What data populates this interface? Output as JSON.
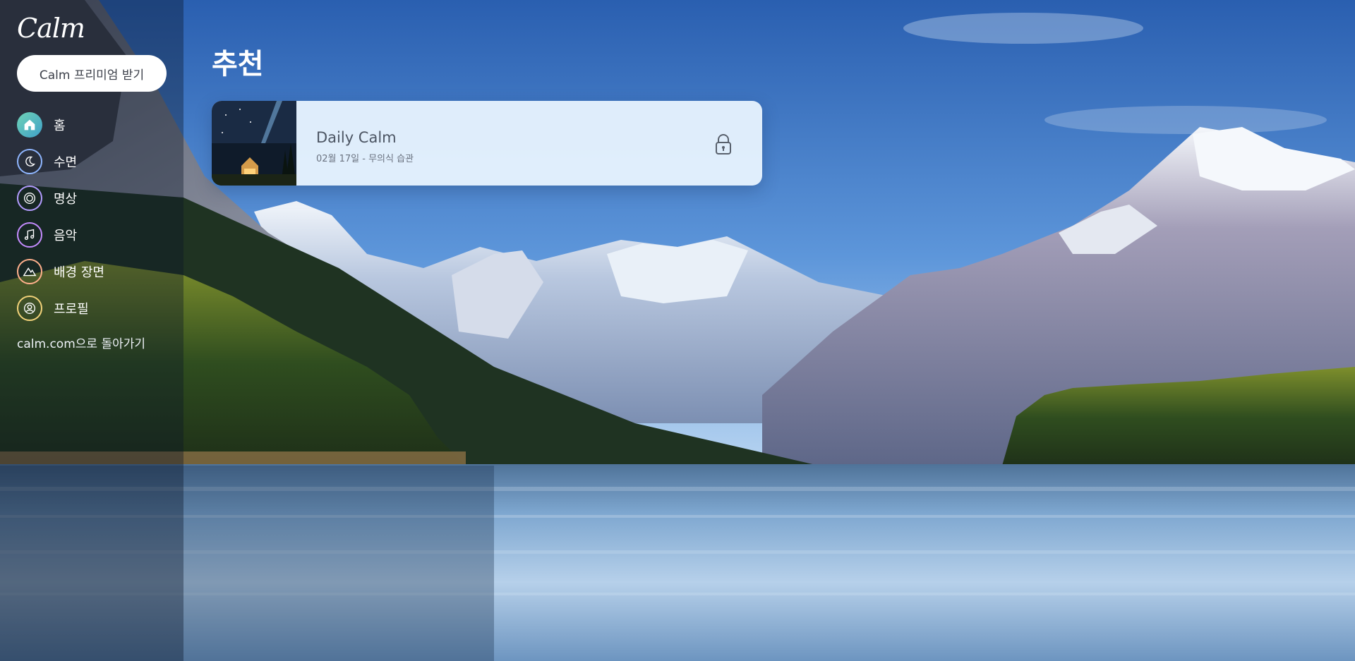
{
  "sidebar": {
    "logo": "Calm",
    "premium_button": "Calm 프리미엄 받기",
    "items": [
      {
        "label": "홈",
        "icon": "home-icon"
      },
      {
        "label": "수면",
        "icon": "moon-icon"
      },
      {
        "label": "명상",
        "icon": "meditation-circle-icon"
      },
      {
        "label": "음악",
        "icon": "music-note-icon"
      },
      {
        "label": "배경 장면",
        "icon": "mountain-scene-icon"
      },
      {
        "label": "프로필",
        "icon": "profile-icon"
      }
    ],
    "back_link": "calm.com으로 돌아가기"
  },
  "main": {
    "title": "추천",
    "card": {
      "title": "Daily Calm",
      "subtitle": "02월 17일 - 무의식 습관",
      "icon": "lock-icon"
    }
  },
  "colors": {
    "home_icon_bg": "#5fc7a8",
    "moon_ring": "#8fb6ff",
    "meditation_ring": "#b39cff",
    "music_ring": "#c58cff",
    "scene_ring": "#ffb08c",
    "profile_ring": "#f3d37a"
  }
}
